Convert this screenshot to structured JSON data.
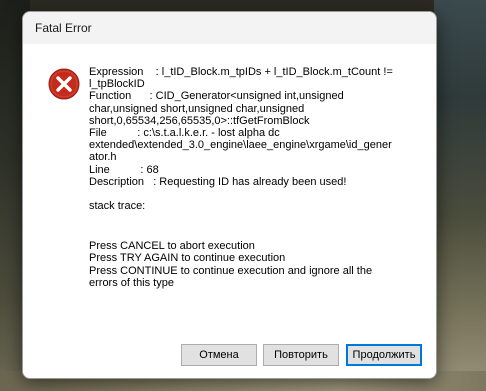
{
  "window": {
    "title": "Fatal Error"
  },
  "icon": {
    "name": "error-icon",
    "color": "#c42b1c"
  },
  "message": {
    "lines": [
      "Expression    : l_tID_Block.m_tpIDs + l_tID_Block.m_tCount !=",
      "l_tpBlockID",
      "Function      : CID_Generator<unsigned int,unsigned",
      "char,unsigned short,unsigned char,unsigned",
      "short,0,65534,256,65535,0>::tfGetFromBlock",
      "File          : c:\\s.t.a.l.k.e.r. - lost alpha dc",
      "extended\\extended_3.0_engine\\laee_engine\\xrgame\\id_gener",
      "ator.h",
      "Line          : 68",
      "Description   : Requesting ID has already been used!"
    ],
    "stack_trace": "stack trace:",
    "instructions": [
      "Press CANCEL to abort execution",
      "Press TRY AGAIN to continue execution",
      "Press CONTINUE to continue execution and ignore all the",
      "errors of this type"
    ]
  },
  "buttons": {
    "cancel": "Отмена",
    "retry": "Повторить",
    "continue": "Продолжить"
  }
}
